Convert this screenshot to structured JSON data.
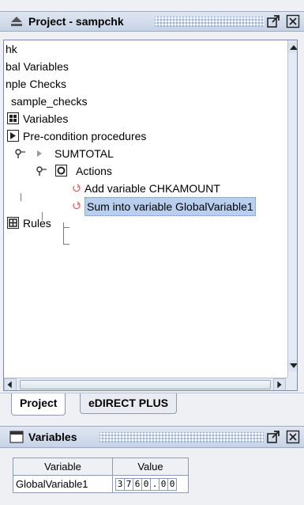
{
  "project_panel": {
    "title": "Project - sampchk",
    "float_icon": "undock-icon",
    "close_icon": "close-icon",
    "tree": [
      {
        "label": "hk"
      },
      {
        "label": "bal Variables"
      },
      {
        "label": "nple Checks"
      },
      {
        "label": "sample_checks"
      },
      {
        "label": "Variables",
        "icon": "variables-icon"
      },
      {
        "label": "Pre-condition procedures",
        "icon": "procedure-icon"
      },
      {
        "label": "SUMTOTAL",
        "icon": "collapsed-arrow-icon"
      },
      {
        "label": "Actions",
        "icon": "actions-icon"
      },
      {
        "label": "Add variable CHKAMOUNT",
        "icon": "action-item-icon"
      },
      {
        "label": "Sum into variable GlobalVariable1",
        "icon": "action-item-icon",
        "selected": true
      },
      {
        "label": "Rules",
        "icon": "rules-icon"
      }
    ],
    "tabs": [
      {
        "label": "Project",
        "active": true
      },
      {
        "label": "eDIRECT PLUS",
        "active": false
      }
    ]
  },
  "variables_panel": {
    "title": "Variables",
    "columns": [
      "Variable",
      "Value"
    ],
    "rows": [
      {
        "variable": "GlobalVariable1",
        "value_digits": [
          "3",
          "7",
          "6",
          "0",
          ".",
          "0",
          "0"
        ]
      }
    ]
  },
  "colors": {
    "titlebar": "#c7d3e6",
    "selection": "#b8cff0",
    "background": "#eef0f4"
  }
}
